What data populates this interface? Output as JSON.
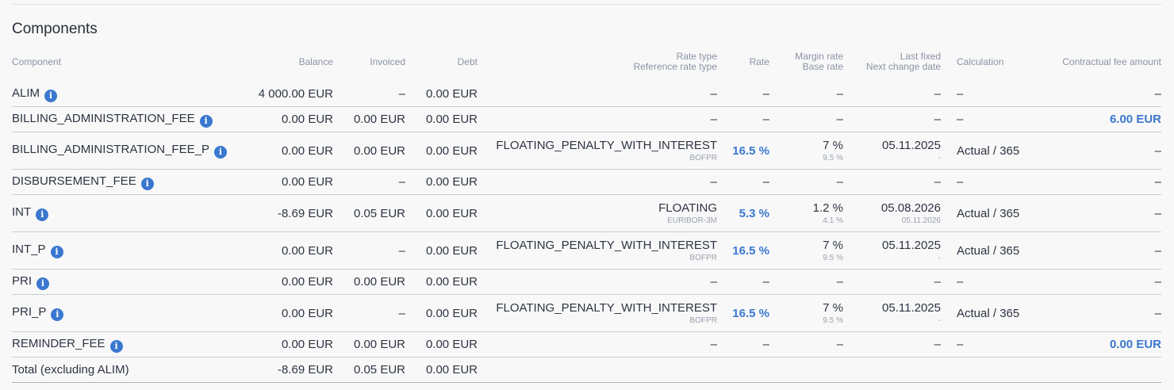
{
  "section": {
    "title": "Components"
  },
  "headers": {
    "component": "Component",
    "balance": "Balance",
    "invoiced": "Invoiced",
    "debt": "Debt",
    "rate_type": "Rate type",
    "reference_rate_type": "Reference rate type",
    "rate": "Rate",
    "margin_rate": "Margin rate",
    "base_rate": "Base rate",
    "last_fixed": "Last fixed",
    "next_change_date": "Next change date",
    "calculation": "Calculation",
    "fee_amount": "Contractual fee amount"
  },
  "rows": [
    {
      "name": "ALIM",
      "balance": "4 000.00 EUR",
      "invoiced": "–",
      "debt": "0.00 EUR",
      "rate_type": "–",
      "ref_rate": "",
      "rate": "–",
      "margin": "–",
      "base": "",
      "last_fixed": "–",
      "next_change": "",
      "calculation": "–",
      "fee": "–"
    },
    {
      "name": "BILLING_ADMINISTRATION_FEE",
      "balance": "0.00 EUR",
      "invoiced": "0.00 EUR",
      "debt": "0.00 EUR",
      "rate_type": "–",
      "ref_rate": "",
      "rate": "–",
      "margin": "–",
      "base": "",
      "last_fixed": "–",
      "next_change": "",
      "calculation": "–",
      "fee": "6.00 EUR"
    },
    {
      "name": "BILLING_ADMINISTRATION_FEE_P",
      "balance": "0.00 EUR",
      "invoiced": "0.00 EUR",
      "debt": "0.00 EUR",
      "rate_type": "FLOATING_PENALTY_WITH_INTEREST",
      "ref_rate": "BOFPR",
      "rate": "16.5 %",
      "margin": "7 %",
      "base": "9.5 %",
      "last_fixed": "05.11.2025",
      "next_change": "-",
      "calculation": "Actual / 365",
      "fee": "–"
    },
    {
      "name": "DISBURSEMENT_FEE",
      "balance": "0.00 EUR",
      "invoiced": "–",
      "debt": "0.00 EUR",
      "rate_type": "–",
      "ref_rate": "",
      "rate": "–",
      "margin": "–",
      "base": "",
      "last_fixed": "–",
      "next_change": "",
      "calculation": "–",
      "fee": "–"
    },
    {
      "name": "INT",
      "balance": "-8.69 EUR",
      "invoiced": "0.05 EUR",
      "debt": "0.00 EUR",
      "rate_type": "FLOATING",
      "ref_rate": "EURIBOR-3M",
      "rate": "5.3 %",
      "margin": "1.2 %",
      "base": "4.1 %",
      "last_fixed": "05.08.2026",
      "next_change": "05.11.2026",
      "calculation": "Actual / 365",
      "fee": "–"
    },
    {
      "name": "INT_P",
      "balance": "0.00 EUR",
      "invoiced": "–",
      "debt": "0.00 EUR",
      "rate_type": "FLOATING_PENALTY_WITH_INTEREST",
      "ref_rate": "BOFPR",
      "rate": "16.5 %",
      "margin": "7 %",
      "base": "9.5 %",
      "last_fixed": "05.11.2025",
      "next_change": "-",
      "calculation": "Actual / 365",
      "fee": "–"
    },
    {
      "name": "PRI",
      "balance": "0.00 EUR",
      "invoiced": "0.00 EUR",
      "debt": "0.00 EUR",
      "rate_type": "–",
      "ref_rate": "",
      "rate": "–",
      "margin": "–",
      "base": "",
      "last_fixed": "–",
      "next_change": "",
      "calculation": "–",
      "fee": "–"
    },
    {
      "name": "PRI_P",
      "balance": "0.00 EUR",
      "invoiced": "–",
      "debt": "0.00 EUR",
      "rate_type": "FLOATING_PENALTY_WITH_INTEREST",
      "ref_rate": "BOFPR",
      "rate": "16.5 %",
      "margin": "7 %",
      "base": "9.5 %",
      "last_fixed": "05.11.2025",
      "next_change": "-",
      "calculation": "Actual / 365",
      "fee": "–"
    },
    {
      "name": "REMINDER_FEE",
      "balance": "0.00 EUR",
      "invoiced": "0.00 EUR",
      "debt": "0.00 EUR",
      "rate_type": "–",
      "ref_rate": "",
      "rate": "–",
      "margin": "–",
      "base": "",
      "last_fixed": "–",
      "next_change": "",
      "calculation": "–",
      "fee": "0.00 EUR"
    }
  ],
  "total": {
    "label": "Total (excluding ALIM)",
    "balance": "-8.69 EUR",
    "invoiced": "0.05 EUR",
    "debt": "0.00 EUR"
  },
  "info_glyph": "i",
  "icons": {
    "info": "info-icon"
  },
  "colors": {
    "accent": "#3a78cf",
    "text": "#2d3440",
    "muted": "#8a93a3"
  }
}
